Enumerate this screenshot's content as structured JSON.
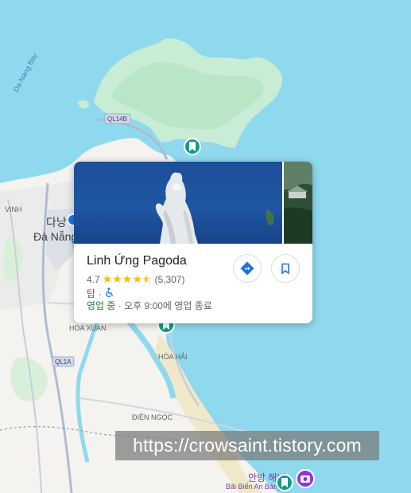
{
  "map": {
    "labels": {
      "bay": "Da Nang Bay",
      "road_ql14b": "QL14B",
      "road_ql1a": "QL1A",
      "city_korean": "다낭",
      "city_vietnamese": "Đà Nẵng",
      "vinh": "VINH",
      "hoa_xuan": "HOA XUAN",
      "hoa_hai": "HÒA HẢI",
      "dien_ngoc": "ĐIỆN NGỌC",
      "an_bang_korean": "안방 해변",
      "an_bang_vn": "Bãi Biển An Bàng"
    },
    "colors": {
      "water": "#8fd9ee",
      "land": "#f4f3ef",
      "forest": "#c9ecd4",
      "marker": "#0f9d8a"
    }
  },
  "place_card": {
    "name": "Linh Ứng Pagoda",
    "rating": "4.7",
    "stars": "★★★★",
    "review_count": "(5,307)",
    "category": "탑",
    "separator": "·",
    "accessible_icon": "wheelchair-icon",
    "open_status": "영업 중",
    "hours": "· 오후 9:00에 영업 종료",
    "buttons": {
      "directions_icon": "directions-icon",
      "save_icon": "bookmark-icon"
    }
  },
  "watermark": "https://crowsaint.tistory.com"
}
